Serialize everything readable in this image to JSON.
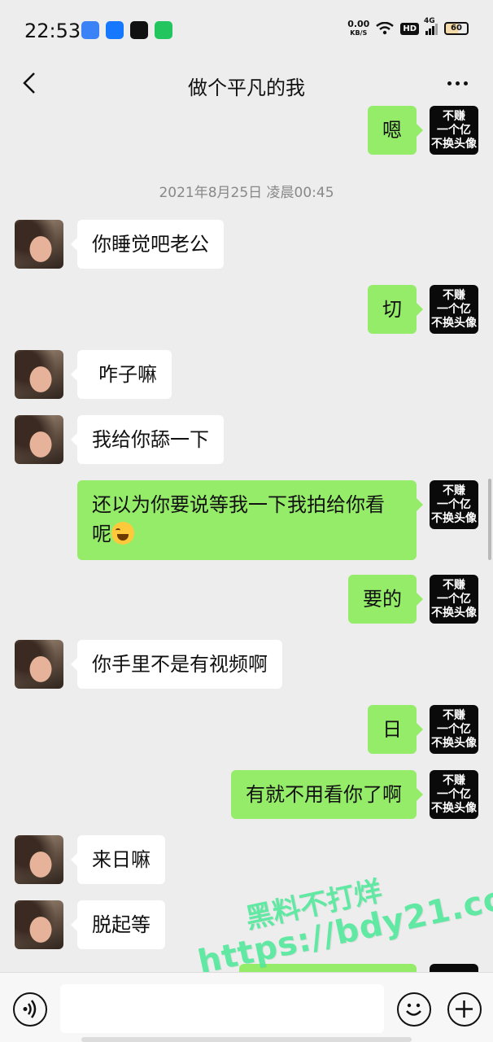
{
  "status_bar": {
    "time": "22:53",
    "net_speed": "0.00",
    "net_unit": "KB/S",
    "hd": "HD",
    "network": "4G",
    "battery": "60"
  },
  "header": {
    "title": "做个平凡的我"
  },
  "timestamp": "2021年8月25日 凌晨00:45",
  "my_avatar_lines": [
    "不赚",
    "一个亿",
    "不换头像"
  ],
  "messages": [
    {
      "side": "right",
      "text": "嗯"
    },
    {
      "side": "left",
      "text": "你睡觉吧老公"
    },
    {
      "side": "right",
      "text": "切"
    },
    {
      "side": "left",
      "text": "咋子嘛"
    },
    {
      "side": "left",
      "text": "我给你舔一下"
    },
    {
      "side": "right",
      "text_line1": "还以为你要说等我一下我拍给你看",
      "text_line2": "呢"
    },
    {
      "side": "right",
      "text": "要的"
    },
    {
      "side": "left",
      "text": "你手里不是有视频啊"
    },
    {
      "side": "right",
      "text": "日"
    },
    {
      "side": "right",
      "text": "有就不用看你了啊"
    },
    {
      "side": "left",
      "text": "来日嘛"
    },
    {
      "side": "left",
      "text": "脱起等"
    }
  ],
  "watermark": {
    "line1": "黑料不打烊",
    "line2": "https://bdy21.co"
  },
  "input": {
    "value": "",
    "placeholder": ""
  },
  "colors": {
    "my_bubble": "#95ec69",
    "their_bubble": "#ffffff",
    "background": "#ededed"
  }
}
